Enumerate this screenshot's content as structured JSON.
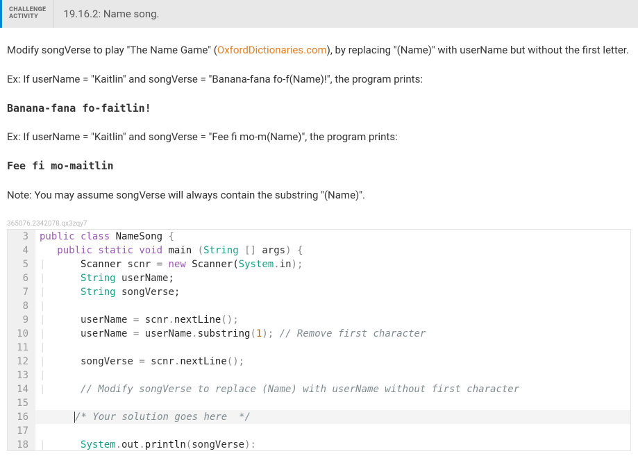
{
  "header": {
    "badge_line1": "CHALLENGE",
    "badge_line2": "ACTIVITY",
    "title": "19.16.2: Name song."
  },
  "content": {
    "p1_a": "Modify songVerse to play \"The Name Game\" (",
    "link_text": "OxfordDictionaries.com",
    "p1_b": "), by replacing \"(Name)\" with userName but without the first letter.",
    "p2": "Ex: If userName = \"Kaitlin\" and songVerse = \"Banana-fana fo-f(Name)!\", the program prints:",
    "out1": "Banana-fana fo-faitlin!",
    "p3": "Ex: If userName = \"Kaitlin\" and songVerse = \"Fee fi mo-m(Name)\", the program prints:",
    "out2": "Fee fi mo-maitlin",
    "p4": "Note: You may assume songVerse will always contain the substring \"(Name)\"."
  },
  "hash": "365076.2342078.qx3zqy7",
  "code": {
    "l3": {
      "n": "3",
      "kw1": "public",
      "kw2": "class",
      "id": "NameSong",
      "p": " {"
    },
    "l4": {
      "n": "4",
      "pad": "   ",
      "kw1": "public",
      "kw2": "static",
      "kw3": "void",
      "id": "main",
      "p1": " (",
      "ty": "String",
      "arr": " []",
      "arg": " args",
      "p2": ") {"
    },
    "l5": {
      "n": "5",
      "pad": "      ",
      "ty": "Scanner",
      "id": " scnr ",
      "op": "=",
      "kw": " new ",
      "ty2": "Scanner(",
      "sys": "System",
      "dot": ".",
      "in": "in",
      "p": ");"
    },
    "l6": {
      "n": "6",
      "pad": "      ",
      "ty": "String",
      "id": " userName;"
    },
    "l7": {
      "n": "7",
      "pad": "      ",
      "ty": "String",
      "id": " songVerse;"
    },
    "l8": {
      "n": "8"
    },
    "l9": {
      "n": "9",
      "pad": "      ",
      "lhs": "userName ",
      "op": "=",
      "rhs": " scnr",
      "dot": ".",
      "m": "nextLine",
      "p": "();"
    },
    "l10": {
      "n": "10",
      "pad": "      ",
      "lhs": "userName ",
      "op": "=",
      "rhs": " userName",
      "dot": ".",
      "m": "substring",
      "p1": "(",
      "num": "1",
      "p2": "); ",
      "c": "// Remove first character"
    },
    "l11": {
      "n": "11"
    },
    "l12": {
      "n": "12",
      "pad": "      ",
      "lhs": "songVerse ",
      "op": "=",
      "rhs": " scnr",
      "dot": ".",
      "m": "nextLine",
      "p": "();"
    },
    "l13": {
      "n": "13"
    },
    "l14": {
      "n": "14",
      "pad": "      ",
      "c": "// Modify songVerse to replace (Name) with userName without first character"
    },
    "l15": {
      "n": "15"
    },
    "l16": {
      "n": "16",
      "pad": "      ",
      "c": "/* Your solution goes here  */"
    },
    "l17": {
      "n": "17"
    },
    "l18": {
      "n": "18",
      "pad": "      ",
      "sys": "System",
      "dot1": ".",
      "out": "out",
      "dot2": ".",
      "m": "println",
      "p1": "(",
      "arg": "songVerse",
      "p2": "):"
    }
  }
}
